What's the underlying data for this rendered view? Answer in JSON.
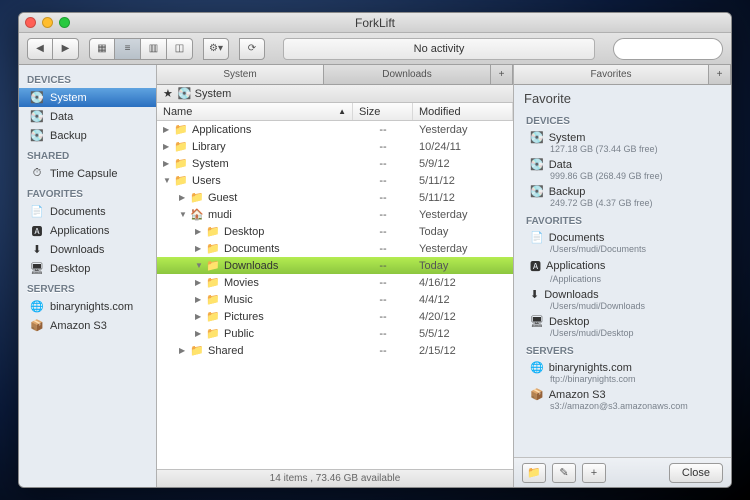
{
  "title": "ForkLift",
  "toolbar": {
    "activity": "No activity",
    "search_placeholder": ""
  },
  "sidebar": {
    "groups": [
      {
        "label": "DEVICES",
        "items": [
          {
            "icon": "💽",
            "label": "System",
            "sel": true
          },
          {
            "icon": "💽",
            "label": "Data"
          },
          {
            "icon": "💽",
            "label": "Backup"
          }
        ]
      },
      {
        "label": "SHARED",
        "items": [
          {
            "icon": "⏱",
            "label": "Time Capsule"
          }
        ]
      },
      {
        "label": "FAVORITES",
        "items": [
          {
            "icon": "📄",
            "label": "Documents"
          },
          {
            "icon": "🅰",
            "label": "Applications"
          },
          {
            "icon": "⬇",
            "label": "Downloads"
          },
          {
            "icon": "🖥",
            "label": "Desktop"
          }
        ]
      },
      {
        "label": "SERVERS",
        "items": [
          {
            "icon": "🌐",
            "label": "binarynights.com"
          },
          {
            "icon": "📦",
            "label": "Amazon S3"
          }
        ]
      }
    ]
  },
  "left_pane": {
    "tabs": [
      {
        "label": "System",
        "active": true
      },
      {
        "label": "Downloads"
      }
    ],
    "path": [
      {
        "icon": "★",
        "label": ""
      },
      {
        "icon": "💽",
        "label": "System"
      }
    ],
    "columns": {
      "name": "Name",
      "size": "Size",
      "modified": "Modified"
    },
    "rows": [
      {
        "indent": 0,
        "exp": "▶",
        "icon": "📁",
        "name": "Applications",
        "size": "--",
        "mod": "Yesterday"
      },
      {
        "indent": 0,
        "exp": "▶",
        "icon": "📁",
        "name": "Library",
        "size": "--",
        "mod": "10/24/11"
      },
      {
        "indent": 0,
        "exp": "▶",
        "icon": "📁",
        "name": "System",
        "size": "--",
        "mod": "5/9/12"
      },
      {
        "indent": 0,
        "exp": "▼",
        "icon": "📁",
        "name": "Users",
        "size": "--",
        "mod": "5/11/12"
      },
      {
        "indent": 1,
        "exp": "▶",
        "icon": "📁",
        "name": "Guest",
        "size": "--",
        "mod": "5/11/12"
      },
      {
        "indent": 1,
        "exp": "▼",
        "icon": "🏠",
        "name": "mudi",
        "size": "--",
        "mod": "Yesterday"
      },
      {
        "indent": 2,
        "exp": "▶",
        "icon": "📁",
        "name": "Desktop",
        "size": "--",
        "mod": "Today"
      },
      {
        "indent": 2,
        "exp": "▶",
        "icon": "📁",
        "name": "Documents",
        "size": "--",
        "mod": "Yesterday"
      },
      {
        "indent": 2,
        "exp": "▼",
        "icon": "📁",
        "name": "Downloads",
        "size": "--",
        "mod": "Today",
        "sel": true
      },
      {
        "indent": 2,
        "exp": "▶",
        "icon": "📁",
        "name": "Movies",
        "size": "--",
        "mod": "4/16/12"
      },
      {
        "indent": 2,
        "exp": "▶",
        "icon": "📁",
        "name": "Music",
        "size": "--",
        "mod": "4/4/12"
      },
      {
        "indent": 2,
        "exp": "▶",
        "icon": "📁",
        "name": "Pictures",
        "size": "--",
        "mod": "4/20/12"
      },
      {
        "indent": 2,
        "exp": "▶",
        "icon": "📁",
        "name": "Public",
        "size": "--",
        "mod": "5/5/12"
      },
      {
        "indent": 1,
        "exp": "▶",
        "icon": "📁",
        "name": "Shared",
        "size": "--",
        "mod": "2/15/12"
      }
    ],
    "status": "14 items , 73.46 GB available"
  },
  "right_pane": {
    "tabs": [
      {
        "label": "Favorites",
        "active": true
      }
    ],
    "title": "Favorite",
    "groups": [
      {
        "label": "DEVICES",
        "items": [
          {
            "icon": "💽",
            "name": "System",
            "sub": "127.18 GB (73.44 GB free)"
          },
          {
            "icon": "💽",
            "name": "Data",
            "sub": "999.86 GB (268.49 GB free)"
          },
          {
            "icon": "💽",
            "name": "Backup",
            "sub": "249.72 GB (4.37 GB free)"
          }
        ]
      },
      {
        "label": "FAVORITES",
        "items": [
          {
            "icon": "📄",
            "name": "Documents",
            "sub": "/Users/mudi/Documents"
          },
          {
            "icon": "🅰",
            "name": "Applications",
            "sub": "/Applications"
          },
          {
            "icon": "⬇",
            "name": "Downloads",
            "sub": "/Users/mudi/Downloads"
          },
          {
            "icon": "🖥",
            "name": "Desktop",
            "sub": "/Users/mudi/Desktop"
          }
        ]
      },
      {
        "label": "SERVERS",
        "items": [
          {
            "icon": "🌐",
            "name": "binarynights.com",
            "sub": "ftp://binarynights.com"
          },
          {
            "icon": "📦",
            "name": "Amazon S3",
            "sub": "s3://amazon@s3.amazonaws.com"
          }
        ]
      }
    ],
    "footer": {
      "new": "📁",
      "edit": "✎",
      "add": "+",
      "close": "Close"
    }
  }
}
